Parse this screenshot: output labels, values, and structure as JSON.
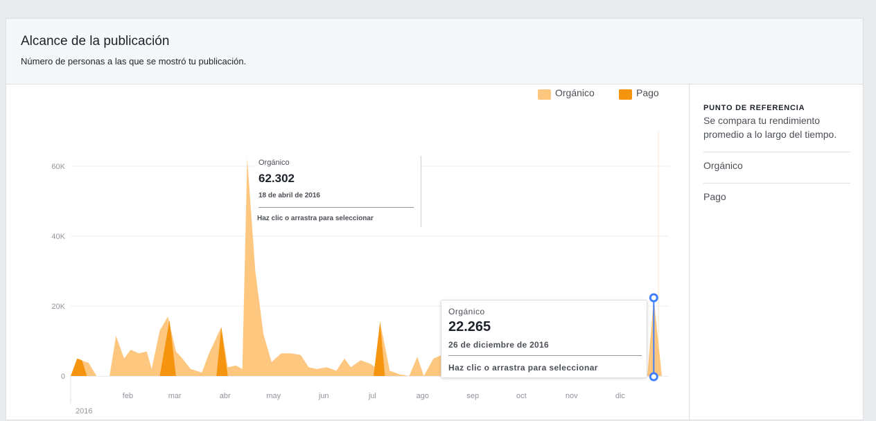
{
  "header": {
    "title": "Alcance de la publicación",
    "subtitle": "Número de personas a las que se mostró tu publicación."
  },
  "legend": {
    "organic": "Orgánico",
    "paid": "Pago"
  },
  "colors": {
    "organic": "#fdc77f",
    "paid": "#f5940f",
    "marker": "#4080ff"
  },
  "tooltips": [
    {
      "label": "Orgánico",
      "value": "62.302",
      "date": "18 de abril de 2016",
      "hint": "Haz clic o arrastra para seleccionar"
    },
    {
      "label": "Orgánico",
      "value": "22.265",
      "date": "26 de diciembre de 2016",
      "hint": "Haz clic o arrastra para seleccionar"
    }
  ],
  "benchmark": {
    "title": "PUNTO DE REFERENCIA",
    "description": "Se compara tu rendimiento promedio a lo largo del tiempo.",
    "items": [
      "Orgánico",
      "Pago"
    ]
  },
  "chart_data": {
    "type": "area",
    "xlabel": "",
    "ylabel": "",
    "ylim": [
      0,
      60000
    ],
    "yticks": [
      0,
      20000,
      40000,
      60000
    ],
    "ytick_labels": [
      "0",
      "20K",
      "40K",
      "60K"
    ],
    "xtick_labels": [
      "feb",
      "mar",
      "abr",
      "may",
      "jun",
      "jul",
      "ago",
      "sep",
      "oct",
      "nov",
      "dic"
    ],
    "xtick_dates": [
      "2016-02-01",
      "2016-03-01",
      "2016-04-01",
      "2016-05-01",
      "2016-06-01",
      "2016-07-01",
      "2016-08-01",
      "2016-09-01",
      "2016-10-01",
      "2016-11-01",
      "2016-12-01"
    ],
    "year_label": "2016",
    "xlim": [
      "2016-01-01",
      "2016-12-31"
    ],
    "series": [
      {
        "name": "Orgánico",
        "points": [
          [
            "2016-01-01",
            0
          ],
          [
            "2016-01-07",
            4500
          ],
          [
            "2016-01-12",
            3800
          ],
          [
            "2016-01-17",
            0
          ],
          [
            "2016-01-25",
            0
          ],
          [
            "2016-01-29",
            11500
          ],
          [
            "2016-02-03",
            5000
          ],
          [
            "2016-02-07",
            7500
          ],
          [
            "2016-02-12",
            6500
          ],
          [
            "2016-02-17",
            7000
          ],
          [
            "2016-02-20",
            2000
          ],
          [
            "2016-02-25",
            13000
          ],
          [
            "2016-03-01",
            17000
          ],
          [
            "2016-03-06",
            7000
          ],
          [
            "2016-03-10",
            5000
          ],
          [
            "2016-03-15",
            2000
          ],
          [
            "2016-03-22",
            1000
          ],
          [
            "2016-03-26",
            6000
          ],
          [
            "2016-04-03",
            14000
          ],
          [
            "2016-04-07",
            2500
          ],
          [
            "2016-04-12",
            3000
          ],
          [
            "2016-04-16",
            2000
          ],
          [
            "2016-04-19",
            62302
          ],
          [
            "2016-04-24",
            30000
          ],
          [
            "2016-04-29",
            12000
          ],
          [
            "2016-05-04",
            4000
          ],
          [
            "2016-05-10",
            6500
          ],
          [
            "2016-05-16",
            6500
          ],
          [
            "2016-05-22",
            6000
          ],
          [
            "2016-05-27",
            2500
          ],
          [
            "2016-06-01",
            2000
          ],
          [
            "2016-06-07",
            2500
          ],
          [
            "2016-06-13",
            1500
          ],
          [
            "2016-06-18",
            5000
          ],
          [
            "2016-06-22",
            2500
          ],
          [
            "2016-06-28",
            4500
          ],
          [
            "2016-07-04",
            3500
          ],
          [
            "2016-07-07",
            2500
          ],
          [
            "2016-07-10",
            15500
          ],
          [
            "2016-07-16",
            1500
          ],
          [
            "2016-07-22",
            500
          ],
          [
            "2016-07-28",
            0
          ],
          [
            "2016-08-02",
            5500
          ],
          [
            "2016-08-06",
            0
          ],
          [
            "2016-08-12",
            5000
          ],
          [
            "2016-08-17",
            6000
          ],
          [
            "2016-08-24",
            1000
          ],
          [
            "2016-08-30",
            500
          ],
          [
            "2016-09-08",
            2000
          ],
          [
            "2016-09-13",
            1000
          ],
          [
            "2016-09-18",
            5000
          ],
          [
            "2016-09-26",
            4500
          ],
          [
            "2016-10-01",
            0
          ],
          [
            "2016-12-10",
            0
          ],
          [
            "2016-12-18",
            1000
          ],
          [
            "2016-12-22",
            0
          ],
          [
            "2016-12-26",
            22265
          ],
          [
            "2016-12-31",
            0
          ]
        ]
      },
      {
        "name": "Pago",
        "points": [
          [
            "2016-01-01",
            0
          ],
          [
            "2016-01-05",
            5000
          ],
          [
            "2016-01-08",
            4500
          ],
          [
            "2016-01-11",
            0
          ],
          [
            "2016-02-25",
            0
          ],
          [
            "2016-03-02",
            16000
          ],
          [
            "2016-03-06",
            0
          ],
          [
            "2016-03-31",
            0
          ],
          [
            "2016-04-03",
            14000
          ],
          [
            "2016-04-07",
            0
          ],
          [
            "2016-07-06",
            0
          ],
          [
            "2016-07-10",
            15500
          ],
          [
            "2016-07-13",
            0
          ],
          [
            "2016-12-31",
            0
          ]
        ]
      }
    ]
  }
}
